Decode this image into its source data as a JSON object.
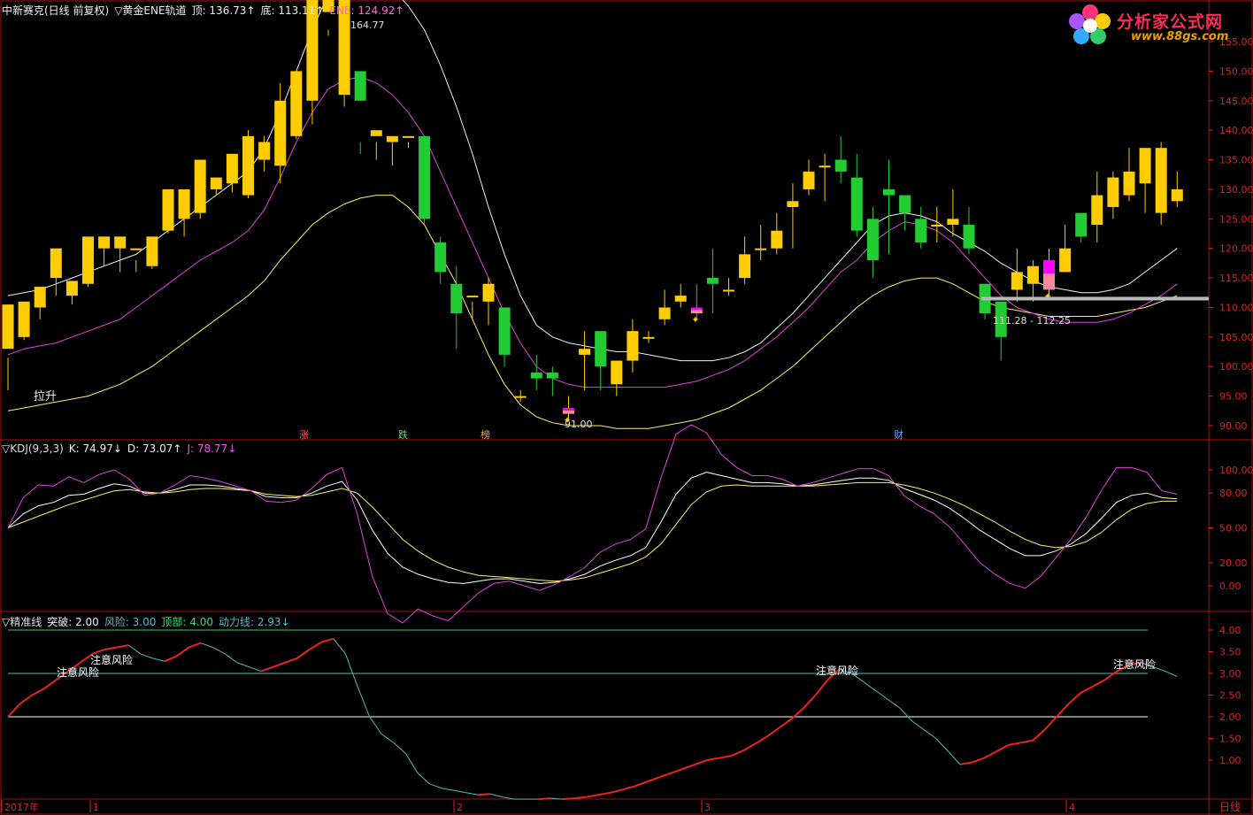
{
  "colors": {
    "bg": "#000000",
    "up": "#ffcc00",
    "down": "#22cc33",
    "frame": "#aa1111",
    "axis": "#dd2222",
    "pink": "#ff55aa",
    "white": "#ffffff",
    "magenta": "#dd44dd",
    "yellow": "#ffee66",
    "teal": "#55bbbb",
    "green": "#33cc66",
    "hl": "#ff00ff",
    "hl2": "#ff8899"
  },
  "header_main": {
    "title": "中新赛克(日线 前复权)",
    "indicator": "▽黄金ENE轨道",
    "top_label": "顶: 136.73↑",
    "bottom_label": "底: 113.11↑",
    "ene_label": "ENE: 124.92↑"
  },
  "header_kdj": {
    "name": "▽KDJ(9,3,3)",
    "k": "K: 74.97↓",
    "d": "D: 73.07↑",
    "j": "J: 78.77↓"
  },
  "header_jz": {
    "name": "▽精准线",
    "tupo": "突破: 2.00",
    "fengxian": "风险: 3.00",
    "dingbu": "顶部: 4.00",
    "dongli": "动力线: 2.93↓"
  },
  "logo": {
    "text": "分析家公式网",
    "url": "www.88gs.com"
  },
  "annotations": {
    "high": "164.77",
    "low": "91.00",
    "lashen": "拉升",
    "range": "111.28 - 112.25",
    "zhang": "涨",
    "die": "跌",
    "bang": "榜",
    "cai": "财",
    "risk": "注意风险"
  },
  "x_axis": {
    "labels": [
      "2017年",
      "1",
      "2",
      "3",
      "4"
    ],
    "period": "日线"
  },
  "chart_data": [
    {
      "type": "candlestick",
      "ylim": [
        88,
        168
      ],
      "yticks": [
        90,
        95,
        100,
        105,
        110,
        115,
        120,
        125,
        130,
        135,
        140,
        145,
        150,
        155
      ],
      "ohlc": [
        [
          103,
          110.5,
          101.5,
          96
        ],
        [
          105,
          111,
          104.5,
          108
        ],
        [
          110,
          113.5,
          108,
          110
        ],
        [
          115,
          120,
          112,
          118
        ],
        [
          112,
          114.5,
          110.5,
          113.5
        ],
        [
          114,
          122,
          113.5,
          120
        ],
        [
          120,
          122,
          117,
          121
        ],
        [
          120,
          122,
          116,
          120
        ],
        [
          120,
          120,
          116,
          118
        ],
        [
          117,
          122,
          116.5,
          117
        ],
        [
          123,
          130,
          122.5,
          129
        ],
        [
          125,
          130,
          122,
          127
        ],
        [
          126,
          135,
          125,
          132
        ],
        [
          130,
          132,
          129,
          131
        ],
        [
          131,
          136,
          129.5,
          131
        ],
        [
          129,
          139,
          128.5,
          140
        ],
        [
          135,
          138,
          133,
          139
        ],
        [
          134,
          145,
          131,
          148
        ],
        [
          139,
          150,
          138.5,
          150
        ],
        [
          145,
          164,
          141,
          162
        ],
        [
          160,
          164,
          157,
          156
        ],
        [
          146,
          164.77,
          144,
          160
        ],
        [
          150,
          145,
          136,
          138
        ],
        [
          139,
          140,
          135,
          138
        ],
        [
          138,
          139,
          134,
          139
        ],
        [
          139,
          139,
          137,
          138
        ],
        [
          139,
          125,
          124,
          128
        ],
        [
          121,
          116,
          114,
          122
        ],
        [
          114,
          109,
          103,
          117
        ],
        [
          112,
          112,
          108,
          111
        ],
        [
          111,
          114,
          107,
          115
        ],
        [
          110,
          102,
          100,
          110
        ],
        [
          95,
          95,
          94,
          96
        ],
        [
          99,
          98,
          96,
          102
        ],
        [
          99,
          98,
          95,
          100
        ],
        [
          92,
          93,
          91,
          95
        ],
        [
          102,
          103,
          96,
          106
        ],
        [
          106,
          100,
          96,
          104
        ],
        [
          97,
          101,
          95,
          101
        ],
        [
          101,
          106,
          99,
          108
        ],
        [
          105,
          105,
          104,
          106
        ],
        [
          108,
          110,
          107,
          113
        ],
        [
          111,
          112,
          110,
          114
        ],
        [
          110,
          109,
          108,
          114
        ],
        [
          115,
          114,
          109,
          120
        ],
        [
          113,
          113,
          112,
          115
        ],
        [
          115,
          119,
          114,
          122
        ],
        [
          120,
          120,
          118,
          124
        ],
        [
          120,
          123,
          119,
          126
        ],
        [
          127,
          128,
          120,
          131
        ],
        [
          130,
          133,
          129,
          135
        ],
        [
          134,
          134,
          128,
          136
        ],
        [
          135,
          133,
          131,
          139
        ],
        [
          132,
          123,
          122,
          136
        ],
        [
          125,
          118,
          115,
          127
        ],
        [
          130,
          129,
          119,
          135
        ],
        [
          129,
          126,
          123,
          128
        ],
        [
          125,
          121,
          120,
          127
        ],
        [
          124,
          124,
          121,
          127
        ],
        [
          124,
          125,
          122,
          130
        ],
        [
          124,
          120,
          119,
          127
        ],
        [
          114,
          109,
          108,
          114
        ],
        [
          111,
          105,
          101,
          111
        ],
        [
          113,
          116,
          111,
          120
        ],
        [
          114,
          117,
          111,
          118
        ],
        [
          113,
          118,
          112,
          120
        ],
        [
          116,
          120,
          117,
          124
        ],
        [
          126,
          122,
          121,
          126
        ],
        [
          124,
          129,
          121,
          133
        ],
        [
          127,
          132,
          125,
          133
        ],
        [
          129,
          133,
          128,
          137
        ],
        [
          131,
          137,
          126,
          137
        ],
        [
          126,
          137,
          124,
          138
        ],
        [
          128,
          130,
          127,
          133
        ]
      ],
      "ene_upper": [
        112,
        112.5,
        113,
        114,
        115,
        116,
        117,
        118,
        119,
        121,
        123,
        125,
        127,
        129,
        131,
        133,
        137,
        143,
        150,
        157,
        163,
        165.5,
        166.5,
        166,
        164,
        161,
        157,
        151,
        144,
        136,
        127,
        119,
        112,
        107,
        105,
        104,
        103.5,
        103,
        102.5,
        102.5,
        102,
        101.5,
        101,
        101,
        101,
        101.5,
        102.5,
        104,
        106.5,
        109,
        112,
        115,
        118,
        121,
        124,
        125.5,
        126,
        125.5,
        124.5,
        122.5,
        121,
        119.5,
        117.5,
        116,
        114.5,
        113.5,
        113,
        112.5,
        112.5,
        113,
        114,
        116,
        118,
        120
      ],
      "ene_mid": [
        102,
        103,
        103.5,
        104,
        105,
        106,
        107,
        108,
        110,
        112,
        114,
        116,
        118,
        119.5,
        121,
        123,
        126.5,
        132,
        138,
        143,
        147,
        148.5,
        149,
        148,
        146,
        143,
        139,
        133,
        127,
        121,
        115,
        109,
        104,
        100,
        98,
        97,
        96.5,
        96.5,
        96.5,
        96.5,
        96.5,
        96.5,
        97,
        97.5,
        98.5,
        99.5,
        101,
        103,
        105,
        107.5,
        110,
        113,
        116,
        118,
        121,
        123,
        124.5,
        124,
        123,
        121,
        118,
        115,
        112,
        110,
        109,
        108,
        107.5,
        107.5,
        107.5,
        108,
        109,
        110.5,
        112,
        114
      ],
      "ene_lower": [
        92.5,
        93,
        93.5,
        94,
        94.5,
        95,
        96,
        97,
        98.5,
        100,
        102,
        104,
        106,
        108,
        110,
        112,
        114.5,
        118,
        121,
        124,
        126,
        127.5,
        128.5,
        129,
        129,
        127,
        124,
        119,
        114,
        108,
        102,
        97,
        93.5,
        91.5,
        90.5,
        90,
        90,
        90,
        89.5,
        89.5,
        89.5,
        90,
        90.5,
        91,
        92,
        93,
        94.5,
        96,
        98,
        100,
        102.5,
        105,
        107.5,
        110,
        112,
        113.5,
        114.5,
        115,
        115,
        114,
        112.5,
        111,
        110,
        109.5,
        109,
        108.5,
        108.5,
        108.5,
        108.5,
        109,
        109.5,
        110,
        111,
        112
      ]
    },
    {
      "type": "line",
      "name": "KDJ",
      "ylim": [
        -25,
        125
      ],
      "yticks": [
        0,
        20,
        50,
        80,
        100
      ],
      "series": [
        {
          "name": "K",
          "values": [
            50,
            62,
            69,
            72,
            78,
            79,
            84,
            88,
            86,
            80,
            80,
            83,
            87,
            87,
            86,
            84,
            82,
            77,
            76,
            76,
            80,
            86,
            90,
            74,
            48,
            28,
            16,
            10,
            6,
            3,
            2,
            4,
            6,
            6,
            4,
            2,
            3,
            6,
            10,
            17,
            22,
            26,
            33,
            55,
            79,
            93,
            98,
            95,
            92,
            89,
            89,
            88,
            86,
            87,
            89,
            91,
            93,
            93,
            91,
            84,
            79,
            74,
            67,
            58,
            48,
            40,
            32,
            26,
            26,
            30,
            36,
            45,
            58,
            72,
            78,
            80,
            76,
            75
          ]
        },
        {
          "name": "D",
          "values": [
            50,
            55,
            60,
            65,
            70,
            74,
            78,
            82,
            83,
            81,
            80,
            81,
            83,
            84,
            84,
            83,
            82,
            79,
            78,
            77,
            78,
            81,
            84,
            80,
            68,
            54,
            40,
            30,
            22,
            16,
            12,
            9,
            8,
            7,
            6,
            5,
            4,
            5,
            7,
            11,
            15,
            19,
            25,
            36,
            53,
            70,
            81,
            86,
            87,
            86,
            86,
            86,
            86,
            86,
            87,
            88,
            89,
            89,
            89,
            87,
            84,
            80,
            75,
            69,
            62,
            55,
            47,
            40,
            35,
            33,
            34,
            38,
            46,
            57,
            66,
            71,
            73,
            73
          ]
        },
        {
          "name": "J",
          "values": [
            50,
            76,
            87,
            86,
            94,
            89,
            96,
            100,
            92,
            78,
            80,
            87,
            95,
            93,
            90,
            86,
            82,
            73,
            72,
            74,
            84,
            96,
            102,
            62,
            8,
            -24,
            -32,
            -20,
            -26,
            -30,
            -18,
            -6,
            2,
            4,
            0,
            -4,
            1,
            8,
            16,
            29,
            36,
            40,
            49,
            93,
            131,
            139,
            132,
            113,
            102,
            95,
            95,
            92,
            86,
            89,
            93,
            97,
            101,
            101,
            95,
            78,
            69,
            62,
            51,
            36,
            20,
            10,
            2,
            -2,
            8,
            24,
            40,
            59,
            82,
            102,
            102,
            98,
            82,
            79
          ]
        }
      ]
    },
    {
      "type": "line",
      "name": "精准线",
      "ylim": [
        0,
        4.35
      ],
      "yticks": [
        1.0,
        1.5,
        2.0,
        2.5,
        3.0,
        3.5,
        4.0
      ],
      "levels": [
        {
          "name": "突破",
          "value": 2.0
        },
        {
          "name": "风险",
          "value": 3.0
        },
        {
          "name": "顶部",
          "value": 4.0
        }
      ],
      "series": [
        {
          "name": "动力线",
          "values": [
            2.0,
            2.3,
            2.5,
            2.65,
            2.85,
            3.05,
            3.25,
            3.45,
            3.55,
            3.6,
            3.65,
            3.45,
            3.35,
            3.28,
            3.4,
            3.6,
            3.7,
            3.6,
            3.45,
            3.25,
            3.15,
            3.05,
            3.15,
            3.25,
            3.35,
            3.55,
            3.72,
            3.8,
            3.45,
            2.7,
            2.0,
            1.6,
            1.4,
            1.15,
            0.7,
            0.45,
            0.35,
            0.3,
            0.25,
            0.2,
            0.22,
            0.15,
            0.1,
            0.1,
            0.1,
            0.12,
            0.1,
            0.12,
            0.15,
            0.2,
            0.25,
            0.32,
            0.4,
            0.5,
            0.6,
            0.7,
            0.8,
            0.9,
            1.0,
            1.05,
            1.1,
            1.22,
            1.38,
            1.55,
            1.75,
            1.95,
            2.2,
            2.5,
            2.85,
            3.1,
            3.0,
            2.8,
            2.6,
            2.4,
            2.2,
            1.9,
            1.7,
            1.5,
            1.2,
            0.9,
            0.95,
            1.05,
            1.2,
            1.35,
            1.4,
            1.45,
            1.7,
            2.0,
            2.3,
            2.55,
            2.7,
            2.85,
            3.05,
            3.2,
            3.25,
            3.15,
            3.05,
            2.93
          ]
        }
      ]
    }
  ]
}
